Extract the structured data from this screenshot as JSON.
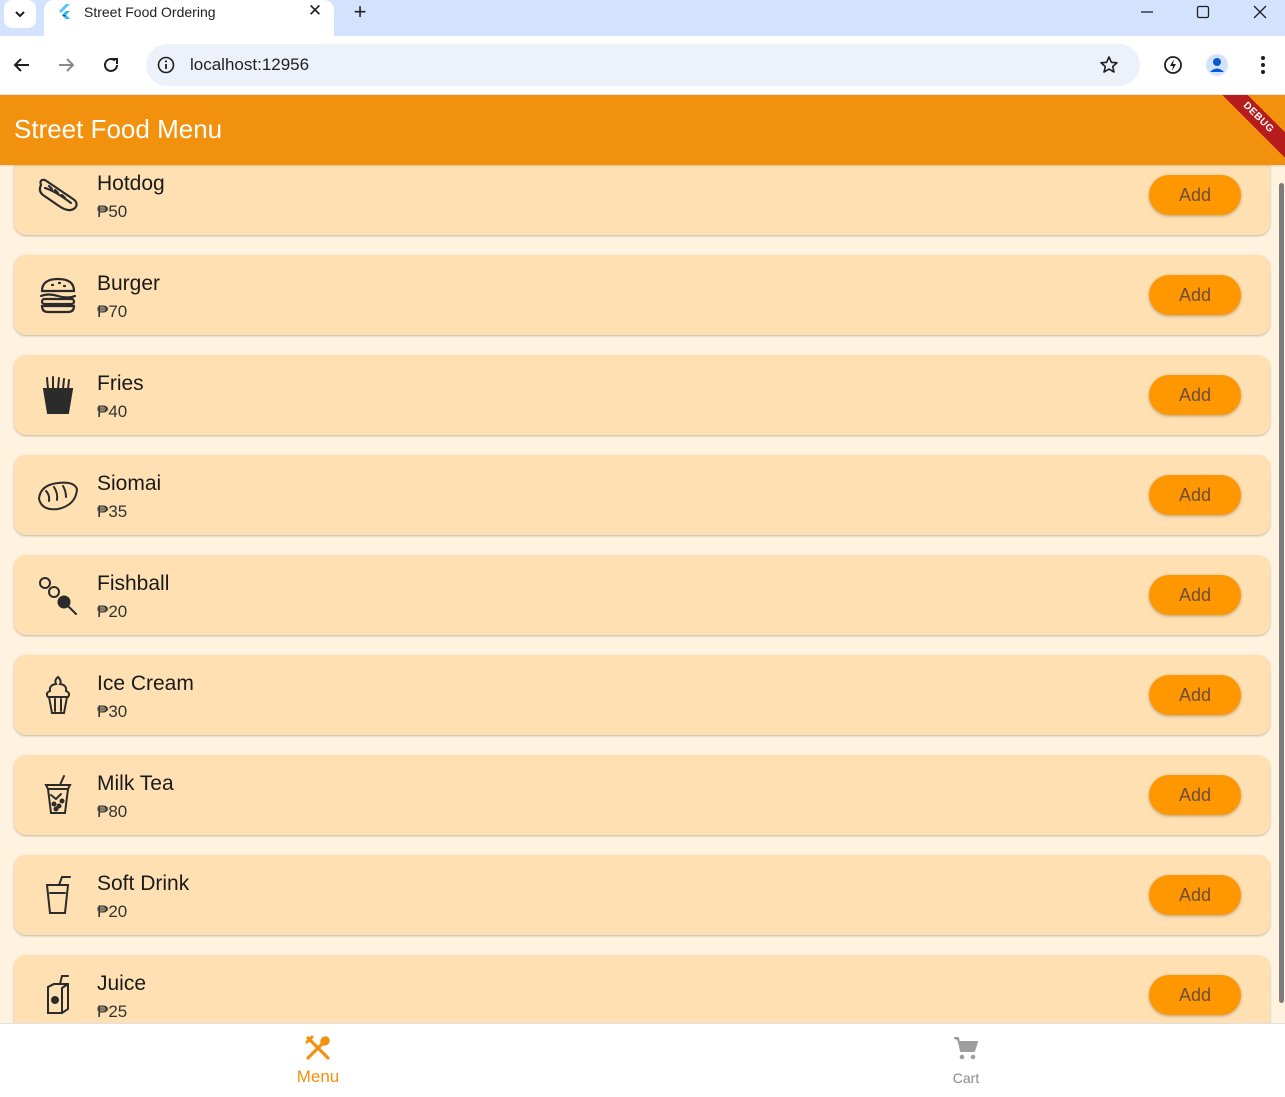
{
  "browser": {
    "tab_title": "Street Food Ordering",
    "url": "localhost:12956"
  },
  "app": {
    "title": "Street Food Menu",
    "debug_label": "DEBUG",
    "accent_color": "#f2910d",
    "button_color": "#ff9800",
    "card_color": "#ffe0b2",
    "background_color": "#fff3e0"
  },
  "menu": {
    "items": [
      {
        "name": "Hotdog",
        "price": "₱50",
        "icon": "hotdog-icon",
        "button": "Add"
      },
      {
        "name": "Burger",
        "price": "₱70",
        "icon": "burger-icon",
        "button": "Add"
      },
      {
        "name": "Fries",
        "price": "₱40",
        "icon": "fries-icon",
        "button": "Add"
      },
      {
        "name": "Siomai",
        "price": "₱35",
        "icon": "dumpling-icon",
        "button": "Add"
      },
      {
        "name": "Fishball",
        "price": "₱20",
        "icon": "skewer-icon",
        "button": "Add"
      },
      {
        "name": "Ice Cream",
        "price": "₱30",
        "icon": "ice-cream-icon",
        "button": "Add"
      },
      {
        "name": "Milk Tea",
        "price": "₱80",
        "icon": "bubble-tea-icon",
        "button": "Add"
      },
      {
        "name": "Soft Drink",
        "price": "₱20",
        "icon": "cup-straw-icon",
        "button": "Add"
      },
      {
        "name": "Juice",
        "price": "₱25",
        "icon": "juice-box-icon",
        "button": "Add"
      }
    ]
  },
  "bottom_nav": {
    "menu_label": "Menu",
    "cart_label": "Cart",
    "active": "Menu"
  }
}
